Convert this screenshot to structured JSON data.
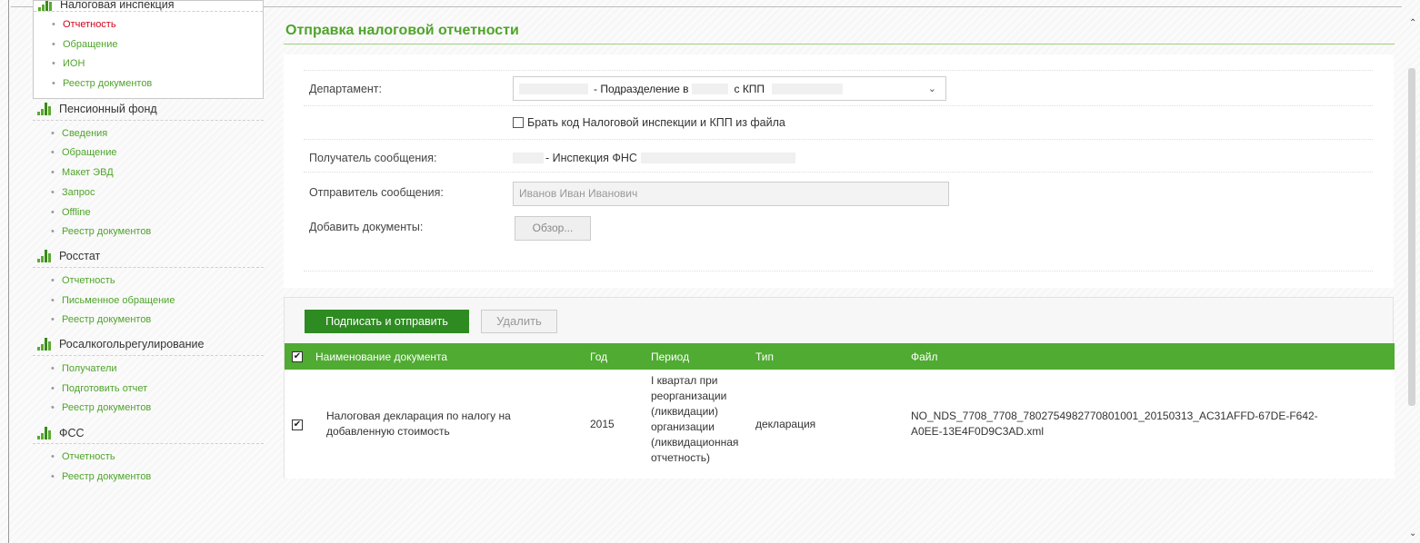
{
  "sidebar": {
    "groups": [
      {
        "title": "Налоговая инспекция",
        "items": [
          "Отчетность",
          "Обращение",
          "ИОН",
          "Реестр документов"
        ],
        "active_item": "Отчетность"
      },
      {
        "title": "Пенсионный фонд",
        "items": [
          "Сведения",
          "Обращение",
          "Макет ЭВД",
          "Запрос",
          "Offline",
          "Реестр документов"
        ]
      },
      {
        "title": "Росстат",
        "items": [
          "Отчетность",
          "Письменное обращение",
          "Реестр документов"
        ]
      },
      {
        "title": "Росалкогольрегулирование",
        "items": [
          "Получатели",
          "Подготовить отчет",
          "Реестр документов"
        ]
      },
      {
        "title": "ФСС",
        "items": [
          "Отчетность",
          "Реестр документов"
        ]
      }
    ]
  },
  "page": {
    "title": "Отправка налоговой отчетности"
  },
  "form": {
    "department_label": "Департамент:",
    "department_value_mid": "- Подразделение в",
    "department_value_kpp": "с КПП",
    "take_from_file_label": "Брать код Налоговой инспекции и КПП из файла",
    "recipient_label": "Получатель сообщения:",
    "recipient_value": "- Инспекция ФНС",
    "sender_label": "Отправитель сообщения:",
    "sender_value": "Иванов Иван Иванович",
    "add_docs_label": "Добавить документы:",
    "browse_label": "Обзор..."
  },
  "actions": {
    "sign_send": "Подписать и отправить",
    "delete": "Удалить"
  },
  "table": {
    "columns": [
      "Наименование документа",
      "Год",
      "Период",
      "Тип",
      "Файл"
    ],
    "rows": [
      {
        "name_line1": "Налоговая декларация по налогу на",
        "name_line2": "добавленную стоимость",
        "year": "2015",
        "period_lines": [
          "I квартал при",
          "реорганизации",
          "(ликвидации)",
          "организации",
          "(ликвидационная",
          "отчетность)"
        ],
        "type": "декларация",
        "file_line1": "NO_NDS_7708_7708_7802754982770801001_20150313_AC31AFFD-67DE-F642-",
        "file_line2": "A0EE-13E4F0D9C3AD.xml",
        "checked": true
      }
    ]
  },
  "colors": {
    "accent": "#4fab31",
    "button_green": "#2e8b22",
    "active_red": "#d0021b"
  },
  "icons": {
    "group_icon": "bar-chart-icon",
    "select_chevron": "chevron-down-icon",
    "checkbox": "checkbox-icon"
  }
}
